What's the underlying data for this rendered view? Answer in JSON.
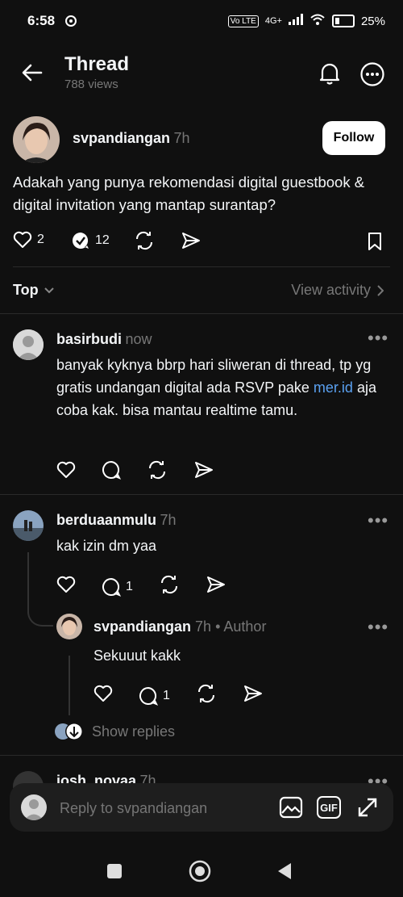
{
  "status": {
    "time": "6:58",
    "network": "4G+",
    "battery": "25%"
  },
  "header": {
    "title": "Thread",
    "views": "788 views"
  },
  "post": {
    "username": "svpandiangan",
    "time": "7h",
    "follow_label": "Follow",
    "text": "Adakah yang punya rekomendasi digital guestbook & digital invitation yang mantap surantap?",
    "likes": "2",
    "replies": "12"
  },
  "sort": {
    "label": "Top",
    "view_activity": "View activity"
  },
  "comments": [
    {
      "username": "basirbudi",
      "time": "now",
      "text_before": "banyak kyknya bbrp hari sliweran di thread, tp yg gratis undangan digital ada RSVP pake ",
      "link": "mer.id",
      "text_after": " aja coba kak. bisa mantau realtime tamu."
    },
    {
      "username": "berduaanmulu",
      "time": "7h",
      "text": "kak izin dm yaa",
      "reply_count": "1"
    },
    {
      "username": "svpandiangan",
      "time": "7h",
      "author_tag": "• Author",
      "text": "Sekuuut kakk",
      "reply_count": "1",
      "show_replies": "Show replies"
    },
    {
      "username": "josh_novaa",
      "time": "7h"
    }
  ],
  "reply_bar": {
    "placeholder": "Reply to svpandiangan",
    "gif_label": "GIF"
  }
}
